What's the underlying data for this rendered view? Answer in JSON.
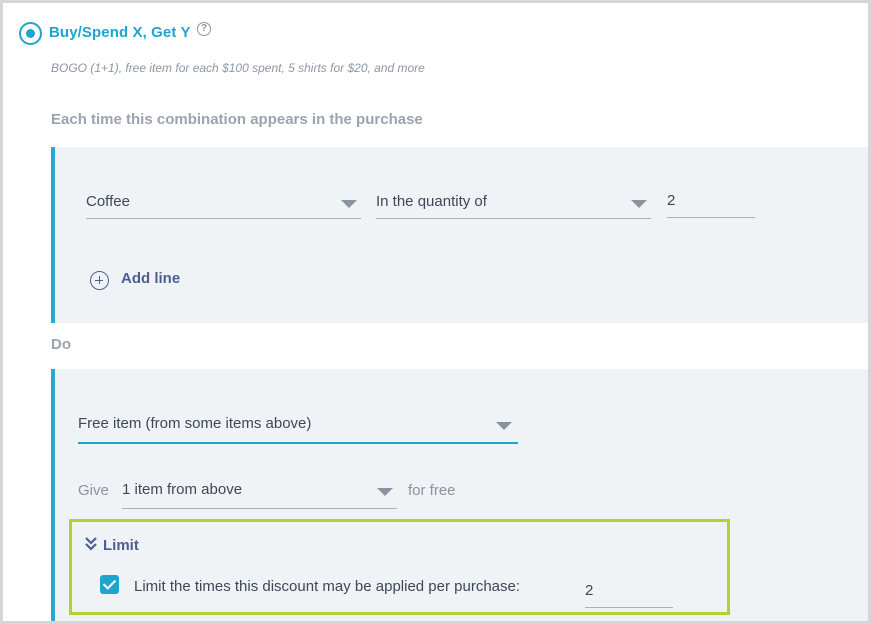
{
  "option": {
    "title": "Buy/Spend X, Get Y",
    "help_icon": "?",
    "description": "BOGO (1+1), free item for each $100 spent, 5 shirts for $20, and more",
    "selected": true
  },
  "condition": {
    "section_label": "Each time this combination appears in the purchase",
    "line": {
      "item_select": "Coffee",
      "quantity_mode_select": "In the quantity of",
      "quantity_value": "2"
    },
    "add_line_label": "Add line"
  },
  "action": {
    "section_label": "Do",
    "type_select": "Free item (from some items above)",
    "give_label": "Give",
    "give_select": "1 item from above",
    "for_free_label": "for free"
  },
  "limit": {
    "header_label": "Limit",
    "checkbox_checked": true,
    "checkbox_label": "Limit the times this discount may be applied per purchase:",
    "value": "2"
  },
  "colors": {
    "accent": "#1ea5cf",
    "panel_bg": "#f0f3f6",
    "highlight_border": "#b6d02e",
    "link": "#4e5e93"
  }
}
